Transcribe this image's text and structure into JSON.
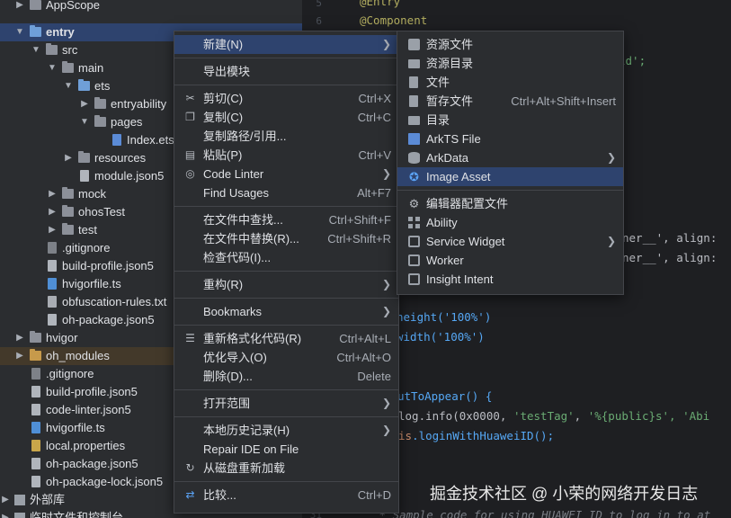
{
  "tree": {
    "items": [
      {
        "label": "AppScope"
      },
      {
        "label": "entry"
      },
      {
        "label": "src"
      },
      {
        "label": "main"
      },
      {
        "label": "ets"
      },
      {
        "label": "entryability"
      },
      {
        "label": "pages"
      },
      {
        "label": "Index.ets"
      },
      {
        "label": "resources"
      },
      {
        "label": "module.json5"
      },
      {
        "label": "mock"
      },
      {
        "label": "ohosTest"
      },
      {
        "label": "test"
      },
      {
        "label": ".gitignore"
      },
      {
        "label": "build-profile.json5"
      },
      {
        "label": "hvigorfile.ts"
      },
      {
        "label": "obfuscation-rules.txt"
      },
      {
        "label": "oh-package.json5"
      },
      {
        "label": "hvigor"
      },
      {
        "label": "oh_modules"
      },
      {
        "label": ".gitignore"
      },
      {
        "label": "build-profile.json5"
      },
      {
        "label": "code-linter.json5"
      },
      {
        "label": "hvigorfile.ts"
      },
      {
        "label": "local.properties"
      },
      {
        "label": "oh-package.json5"
      },
      {
        "label": "oh-package-lock.json5"
      },
      {
        "label": "外部库"
      },
      {
        "label": "临时文件和控制台"
      }
    ]
  },
  "editor": {
    "line_numbers": [
      "5",
      "6",
      "31"
    ],
    "lines": {
      "entry": "@Entry",
      "component": "@Component",
      "world_tail": "ld';",
      "row1_a": "ner__', align:",
      "row1_b": "ner__', align:",
      "height": "height('100%')",
      "width": "width('100%')",
      "about": "utToAppear() {",
      "log_a": "log.info(0x0000, ",
      "log_tag": "'testTag'",
      "log_sep": ", ",
      "log_fmt": "'%{public}s'",
      "log_tail": ", 'Abi",
      "login_kw": "is",
      "login_fn": ".loginWithHuaweiID();",
      "sample": " * Sample code for using HUAWEI ID to log in to at"
    }
  },
  "main_menu": {
    "items": [
      {
        "label": "新建(N)",
        "shortcut": "",
        "submenu": true
      },
      {
        "label": "导出模块",
        "shortcut": ""
      },
      {
        "label": "剪切(C)",
        "shortcut": "Ctrl+X"
      },
      {
        "label": "复制(C)",
        "shortcut": "Ctrl+C"
      },
      {
        "label": "复制路径/引用...",
        "shortcut": ""
      },
      {
        "label": "粘贴(P)",
        "shortcut": "Ctrl+V"
      },
      {
        "label": "Code Linter",
        "shortcut": "",
        "submenu": true
      },
      {
        "label": "Find Usages",
        "shortcut": "Alt+F7"
      },
      {
        "label": "在文件中查找...",
        "shortcut": "Ctrl+Shift+F"
      },
      {
        "label": "在文件中替换(R)...",
        "shortcut": "Ctrl+Shift+R"
      },
      {
        "label": "检查代码(I)...",
        "shortcut": ""
      },
      {
        "label": "重构(R)",
        "shortcut": "",
        "submenu": true
      },
      {
        "label": "Bookmarks",
        "shortcut": "",
        "submenu": true
      },
      {
        "label": "重新格式化代码(R)",
        "shortcut": "Ctrl+Alt+L"
      },
      {
        "label": "优化导入(O)",
        "shortcut": "Ctrl+Alt+O"
      },
      {
        "label": "删除(D)...",
        "shortcut": "Delete"
      },
      {
        "label": "打开范围",
        "shortcut": "",
        "submenu": true
      },
      {
        "label": "本地历史记录(H)",
        "shortcut": "",
        "submenu": true
      },
      {
        "label": "Repair IDE on File",
        "shortcut": ""
      },
      {
        "label": "从磁盘重新加载",
        "shortcut": ""
      },
      {
        "label": "比较...",
        "shortcut": "Ctrl+D"
      }
    ]
  },
  "sub_menu": {
    "items": [
      {
        "label": "资源文件",
        "shortcut": ""
      },
      {
        "label": "资源目录",
        "shortcut": ""
      },
      {
        "label": "文件",
        "shortcut": ""
      },
      {
        "label": "暂存文件",
        "shortcut": "Ctrl+Alt+Shift+Insert"
      },
      {
        "label": "目录",
        "shortcut": ""
      },
      {
        "label": "ArkTS File",
        "shortcut": ""
      },
      {
        "label": "ArkData",
        "shortcut": "",
        "submenu": true
      },
      {
        "label": "Image Asset",
        "shortcut": ""
      },
      {
        "label": "编辑器配置文件",
        "shortcut": ""
      },
      {
        "label": "Ability",
        "shortcut": ""
      },
      {
        "label": "Service Widget",
        "shortcut": "",
        "submenu": true
      },
      {
        "label": "Worker",
        "shortcut": ""
      },
      {
        "label": "Insight Intent",
        "shortcut": ""
      }
    ]
  },
  "icons": {
    "scissors": "scissors-icon",
    "copy": "copy-icon",
    "paste": "paste-icon",
    "linter": "code-linter-icon",
    "format": "format-icon",
    "reload": "reload-icon",
    "compare": "compare-icon"
  },
  "colors": {
    "selection": "#2e436e",
    "menu_bg": "#2b2d30",
    "editor_bg": "#1e1f22"
  },
  "watermark": "掘金技术社区 @ 小荣的网络开发日志"
}
